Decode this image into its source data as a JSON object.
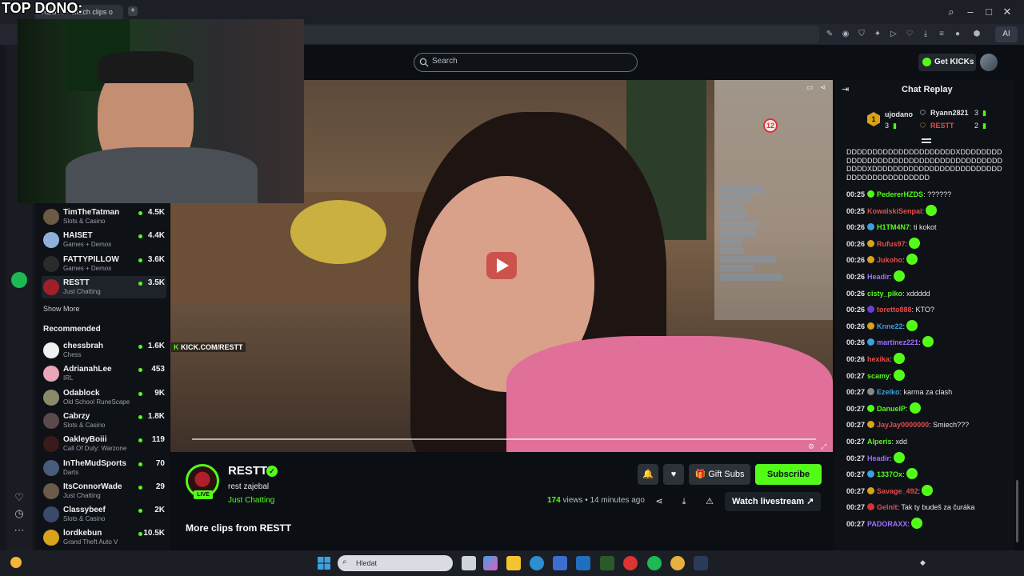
{
  "browser": {
    "tab_title": "RESTT - watch clips o",
    "new_tab_label": "+",
    "ai_label": "AI"
  },
  "overlay": {
    "top_dono": "TOP DONO:"
  },
  "search": {
    "placeholder": "Search"
  },
  "header": {
    "get_kicks": "Get KICKs"
  },
  "sidebar": {
    "following": [
      {
        "name": "TimTheTatman",
        "category": "Slots & Casino",
        "viewers": "4.5K",
        "color": "#6b5a44"
      },
      {
        "name": "HAISET",
        "category": "Games + Demos",
        "viewers": "4.4K",
        "color": "#8fb0d8"
      },
      {
        "name": "FATTYPILLOW",
        "category": "Games + Demos",
        "viewers": "3.6K",
        "color": "#2b2b2b"
      },
      {
        "name": "RESTT",
        "category": "Just Chatting",
        "viewers": "3.5K",
        "color": "#a0202a"
      }
    ],
    "show_more": "Show More",
    "recommended_title": "Recommended",
    "recommended": [
      {
        "name": "chessbrah",
        "category": "Chess",
        "viewers": "1.6K",
        "color": "#f1f1f1"
      },
      {
        "name": "AdrianahLee",
        "category": "IRL",
        "viewers": "453",
        "color": "#e8a6b8"
      },
      {
        "name": "Odablock",
        "category": "Old School RuneScape",
        "viewers": "9K",
        "color": "#8a8a6a"
      },
      {
        "name": "Cabrzy",
        "category": "Slots & Casino",
        "viewers": "1.8K",
        "color": "#5a4a4a"
      },
      {
        "name": "OakleyBoiii",
        "category": "Call Of Duty: Warzone",
        "viewers": "119",
        "color": "#3a1a1a"
      },
      {
        "name": "InTheMudSports",
        "category": "Darts",
        "viewers": "70",
        "color": "#4a5a7a"
      },
      {
        "name": "ItsConnorWade",
        "category": "Just Chatting",
        "viewers": "29",
        "color": "#6a5a4a"
      },
      {
        "name": "Classybeef",
        "category": "Slots & Casino",
        "viewers": "2K",
        "color": "#3a4a6a"
      },
      {
        "name": "lordkebun",
        "category": "Grand Theft Auto V",
        "viewers": "10.5K",
        "color": "#d9a21b"
      }
    ]
  },
  "video": {
    "watermark_k": "K",
    "watermark_text": "KICK.COM/RESTT",
    "badge_number": "12"
  },
  "clip": {
    "streamer": "RESTT",
    "live_label": "LIVE",
    "verified_mark": "✓",
    "title": "rest zajebal",
    "category": "Just Chatting",
    "views_count": "174",
    "views_rest": " views • 14 minutes ago",
    "gift_subs": "Gift Subs",
    "subscribe": "Subscribe",
    "watch_livestream": "Watch livestream",
    "more_clips": "More clips from RESTT"
  },
  "chat": {
    "title": "Chat Replay",
    "leaderboard": {
      "first_rank": "1",
      "first_name": "ujodano",
      "first_count": "3",
      "second_name": "Ryann2821",
      "second_count": "3",
      "third_name": "RESTT",
      "third_count": "2"
    },
    "first_message": "DDDDDDDDDDDDDDDDDDDDDXDDDDDDDDDDDDDDDDDDDDDDDDDDDDDDDDDDDDDDDDDDXDDDDDDDDDDDDDDDDDDDDDDDDDDDDDDDDDDDDDDDDD",
    "messages": [
      {
        "time": "00:25",
        "user": "PedererHZDS",
        "color": "#53fc18",
        "badge": "#53fc18",
        "text": ": ??????",
        "emote": false
      },
      {
        "time": "00:25",
        "user": "KowalskiSenpai",
        "color": "#e64b4b",
        "badge": "",
        "text": ":",
        "emote": true
      },
      {
        "time": "00:26",
        "user": "H1TM4N7",
        "color": "#53fc18",
        "badge": "#3fa0e0",
        "text": ": ti kokot",
        "emote": false
      },
      {
        "time": "00:26",
        "user": "Rufus97",
        "color": "#e64b4b",
        "badge": "#d9a21b",
        "text": ":",
        "emote": true
      },
      {
        "time": "00:26",
        "user": "Jukoho",
        "color": "#e64b4b",
        "badge": "#d9a21b",
        "text": ":",
        "emote": true
      },
      {
        "time": "00:26",
        "user": "Headir",
        "color": "#a070ff",
        "badge": "",
        "text": ":",
        "emote": true
      },
      {
        "time": "00:26",
        "user": "cisty_piko",
        "color": "#53fc18",
        "badge": "",
        "text": ": xddddd",
        "emote": false
      },
      {
        "time": "00:26",
        "user": "toretto888",
        "color": "#e64b4b",
        "badge": "#6a3fd0",
        "text": ": KTO?",
        "emote": false
      },
      {
        "time": "00:26",
        "user": "Knne22",
        "color": "#3fa0e0",
        "badge": "#d9a21b",
        "text": ":",
        "emote": true
      },
      {
        "time": "00:26",
        "user": "martinez221",
        "color": "#a070ff",
        "badge": "#3fa0e0",
        "text": ":",
        "emote": true
      },
      {
        "time": "00:26",
        "user": "hexika",
        "color": "#e64b4b",
        "badge": "",
        "text": ":",
        "emote": true
      },
      {
        "time": "00:27",
        "user": "scamy",
        "color": "#53fc18",
        "badge": "",
        "text": ":",
        "emote": true
      },
      {
        "time": "00:27",
        "user": "Ezelko",
        "color": "#3fa0e0",
        "badge": "#888888",
        "text": ": karma za clash",
        "emote": false
      },
      {
        "time": "00:27",
        "user": "DanuelP",
        "color": "#53fc18",
        "badge": "#53fc18",
        "text": ":",
        "emote": true
      },
      {
        "time": "00:27",
        "user": "JayJay0000000",
        "color": "#e64b4b",
        "badge": "#d9a21b",
        "text": ": Smiech???",
        "emote": false
      },
      {
        "time": "00:27",
        "user": "Alperis",
        "color": "#53fc18",
        "badge": "",
        "text": ": xdd",
        "emote": false
      },
      {
        "time": "00:27",
        "user": "Headir",
        "color": "#a070ff",
        "badge": "",
        "text": ":",
        "emote": true
      },
      {
        "time": "00:27",
        "user": "1337Ox",
        "color": "#53fc18",
        "badge": "#3fa0e0",
        "text": ":",
        "emote": true
      },
      {
        "time": "00:27",
        "user": "Savage_492",
        "color": "#e64b4b",
        "badge": "#d9a21b",
        "text": ":",
        "emote": true
      },
      {
        "time": "00:27",
        "user": "Gelnit",
        "color": "#e64b4b",
        "badge": "#d33333",
        "text": ": Tak ty budeš za čuráka",
        "emote": false
      },
      {
        "time": "00:27",
        "user": "PADORAXX",
        "color": "#a070ff",
        "badge": "",
        "text": ":",
        "emote": true
      }
    ]
  },
  "taskbar": {
    "search_placeholder": "Hledat"
  },
  "colors": {
    "accent": "#53fc18",
    "bg": "#0b0e13"
  }
}
